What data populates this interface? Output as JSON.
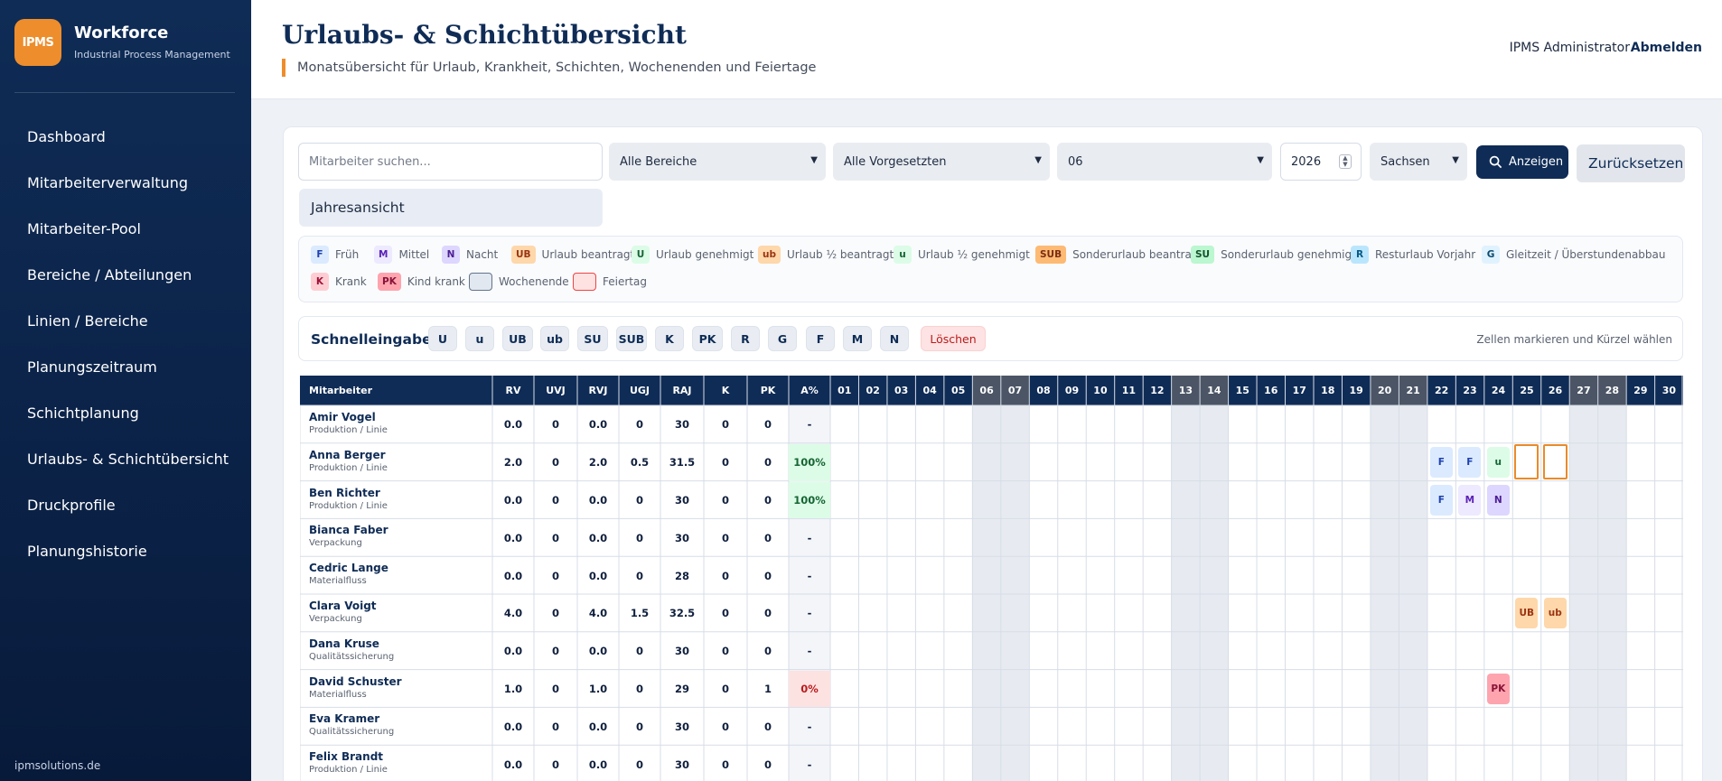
{
  "brand": {
    "logo": "IPMS",
    "name": "Workforce",
    "sub": "Industrial Process Management"
  },
  "nav": [
    "Dashboard",
    "Mitarbeiterverwaltung",
    "Mitarbeiter-Pool",
    "Bereiche / Abteilungen",
    "Linien / Bereiche",
    "Planungszeitraum",
    "Schichtplanung",
    "Urlaubs- & Schichtübersicht",
    "Druckprofile",
    "Planungshistorie"
  ],
  "footer": "ipmsolutions.de",
  "header": {
    "title": "Urlaubs- & Schichtübersicht",
    "subtitle": "Monatsübersicht für Urlaub, Krankheit, Schichten, Wochenenden und Feiertage",
    "user": "IPMS Administrator",
    "logout": "Abmelden"
  },
  "filters": {
    "search_placeholder": "Mitarbeiter suchen...",
    "area": "Alle Bereiche",
    "supervisor": "Alle Vorgesetzten",
    "month": "06",
    "year": "2026",
    "state": "Sachsen",
    "show": "Anzeigen",
    "reset": "Zurücksetzen",
    "year_view": "Jahresansicht"
  },
  "legend": [
    {
      "code": "F",
      "label": "Früh",
      "bg": "#dbeafe",
      "fg": "#1e40af"
    },
    {
      "code": "M",
      "label": "Mittel",
      "bg": "#ede9fe",
      "fg": "#5b21b6"
    },
    {
      "code": "N",
      "label": "Nacht",
      "bg": "#ddd6fe",
      "fg": "#4c1d95"
    },
    {
      "code": "UB",
      "label": "Urlaub beantragt",
      "bg": "#fed7aa",
      "fg": "#9a3412"
    },
    {
      "code": "U",
      "label": "Urlaub genehmigt",
      "bg": "#dcfce7",
      "fg": "#166534"
    },
    {
      "code": "ub",
      "label": "Urlaub ½ beantragt",
      "bg": "#fed7aa",
      "fg": "#9a3412"
    },
    {
      "code": "u",
      "label": "Urlaub ½ genehmigt",
      "bg": "#dcfce7",
      "fg": "#166534"
    },
    {
      "code": "SUB",
      "label": "Sonderurlaub beantragt",
      "bg": "#fdba74",
      "fg": "#7c2d12"
    },
    {
      "code": "SU",
      "label": "Sonderurlaub genehmigt",
      "bg": "#bbf7d0",
      "fg": "#14532d"
    },
    {
      "code": "R",
      "label": "Resturlaub Vorjahr",
      "bg": "#bae6fd",
      "fg": "#075985"
    },
    {
      "code": "G",
      "label": "Gleitzeit / Überstundenabbau",
      "bg": "#e0f2fe",
      "fg": "#0c4a6e"
    },
    {
      "code": "K",
      "label": "Krank",
      "bg": "#fecdd3",
      "fg": "#9f1239"
    },
    {
      "code": "PK",
      "label": "Kind krank",
      "bg": "#fda4af",
      "fg": "#881337"
    },
    {
      "code": "",
      "label": "Wochenende",
      "bg": "#e2e8f0",
      "fg": "#0f172a"
    },
    {
      "code": "",
      "label": "Feiertag",
      "bg": "#fee2e2",
      "fg": "#7f1d1d"
    }
  ],
  "quick": {
    "label": "Schnelleingabe:",
    "buttons": [
      "U",
      "u",
      "UB",
      "ub",
      "SU",
      "SUB",
      "K",
      "PK",
      "R",
      "G",
      "F",
      "M",
      "N"
    ],
    "delete": "Löschen",
    "hint": "Zellen markieren und Kürzel wählen"
  },
  "table": {
    "columns": [
      "Mitarbeiter",
      "RV",
      "UVJ",
      "RVJ",
      "UGJ",
      "RAJ",
      "K",
      "PK",
      "A%"
    ],
    "days": [
      "01",
      "02",
      "03",
      "04",
      "05",
      "06",
      "07",
      "08",
      "09",
      "10",
      "11",
      "12",
      "13",
      "14",
      "15",
      "16",
      "17",
      "18",
      "19",
      "20",
      "21",
      "22",
      "23",
      "24",
      "25",
      "26",
      "27",
      "28",
      "29",
      "30"
    ],
    "weekend_days": [
      "06",
      "07",
      "13",
      "14",
      "20",
      "21",
      "27",
      "28"
    ],
    "rows": [
      {
        "name": "Amir Vogel",
        "area": "Produktion / Linie",
        "vals": [
          "0.0",
          "0",
          "0.0",
          "0",
          "30",
          "0",
          "0",
          "-"
        ],
        "marks": []
      },
      {
        "name": "Anna Berger",
        "area": "Produktion / Linie",
        "vals": [
          "2.0",
          "0",
          "2.0",
          "0.5",
          "31.5",
          "0",
          "0",
          "100%"
        ],
        "marks": [
          {
            "day": "22",
            "code": "F"
          },
          {
            "day": "23",
            "code": "F"
          },
          {
            "day": "24",
            "code": "u"
          }
        ],
        "selected": [
          "25",
          "26"
        ]
      },
      {
        "name": "Ben Richter",
        "area": "Produktion / Linie",
        "vals": [
          "0.0",
          "0",
          "0.0",
          "0",
          "30",
          "0",
          "0",
          "100%"
        ],
        "marks": [
          {
            "day": "22",
            "code": "F"
          },
          {
            "day": "23",
            "code": "M"
          },
          {
            "day": "24",
            "code": "N"
          }
        ]
      },
      {
        "name": "Bianca Faber",
        "area": "Verpackung",
        "vals": [
          "0.0",
          "0",
          "0.0",
          "0",
          "30",
          "0",
          "0",
          "-"
        ],
        "marks": []
      },
      {
        "name": "Cedric Lange",
        "area": "Materialfluss",
        "vals": [
          "0.0",
          "0",
          "0.0",
          "0",
          "28",
          "0",
          "0",
          "-"
        ],
        "marks": []
      },
      {
        "name": "Clara Voigt",
        "area": "Verpackung",
        "vals": [
          "4.0",
          "0",
          "4.0",
          "1.5",
          "32.5",
          "0",
          "0",
          "-"
        ],
        "marks": [
          {
            "day": "25",
            "code": "UB"
          },
          {
            "day": "26",
            "code": "ub"
          }
        ]
      },
      {
        "name": "Dana Kruse",
        "area": "Qualitätssicherung",
        "vals": [
          "0.0",
          "0",
          "0.0",
          "0",
          "30",
          "0",
          "0",
          "-"
        ],
        "marks": []
      },
      {
        "name": "David Schuster",
        "area": "Materialfluss",
        "vals": [
          "1.0",
          "0",
          "1.0",
          "0",
          "29",
          "0",
          "1",
          "0%"
        ],
        "marks": [
          {
            "day": "24",
            "code": "PK"
          }
        ]
      },
      {
        "name": "Eva Kramer",
        "area": "Qualitätssicherung",
        "vals": [
          "0.0",
          "0",
          "0.0",
          "0",
          "30",
          "0",
          "0",
          "-"
        ],
        "marks": []
      },
      {
        "name": "Felix Brandt",
        "area": "Produktion / Linie",
        "vals": [
          "0.0",
          "0",
          "0.0",
          "0",
          "30",
          "0",
          "0",
          "-"
        ],
        "marks": []
      }
    ]
  },
  "colors": {
    "navy": "#0f2c56",
    "accent": "#ee8d2c",
    "weekend_header": "#4b5565",
    "weekend_cell": "#e7ebf1"
  }
}
